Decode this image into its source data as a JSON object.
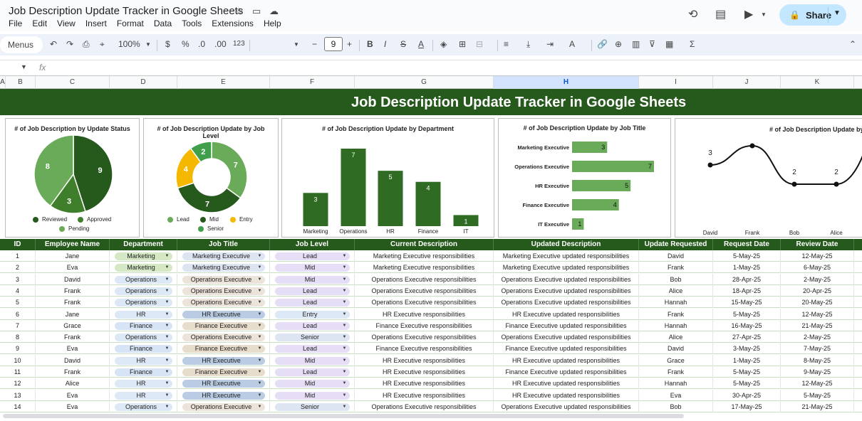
{
  "app": {
    "title": "Job Description Update Tracker in Google Sheets",
    "menus": [
      "File",
      "Edit",
      "View",
      "Insert",
      "Format",
      "Data",
      "Tools",
      "Extensions",
      "Help"
    ],
    "share_label": "Share"
  },
  "toolbar": {
    "menus_label": "Menus",
    "zoom": "100%",
    "currency": "$",
    "percent": "%",
    "dec_decrease": ".0",
    "dec_increase": ".00",
    "number_format": "123",
    "font_size": "9"
  },
  "formula": {
    "fx": "fx"
  },
  "columns": [
    "A",
    "B",
    "C",
    "D",
    "E",
    "F",
    "G",
    "H",
    "I",
    "J",
    "K"
  ],
  "selected_column": "H",
  "banner": {
    "title": "Job Description Update Tracker in Google Sheets"
  },
  "colors": {
    "dark_green": "#265a1c",
    "mid_green": "#3f7f2c",
    "light_green": "#6aab59",
    "amber": "#f5b800",
    "header_green": "#265a1c"
  },
  "charts": {
    "status": {
      "title": "# of Job Description by Update Status",
      "legend": [
        "Reviewed",
        "Approved",
        "Pending"
      ]
    },
    "level": {
      "title": "# of Job Description Update by Job Level",
      "legend": [
        "Lead",
        "Mid",
        "Entry",
        "Senior"
      ]
    },
    "department": {
      "title": "# of Job Description Update by Department"
    },
    "jobtitle": {
      "title": "# of Job Description Update by Job Title"
    },
    "requester": {
      "title": "# of Job Description Update by"
    }
  },
  "chart_data": [
    {
      "type": "pie",
      "title": "# of Job Description by Update Status",
      "categories": [
        "Reviewed",
        "Approved",
        "Pending"
      ],
      "values": [
        9,
        3,
        8
      ],
      "legend_position": "bottom"
    },
    {
      "type": "pie",
      "title": "# of Job Description Update by Job Level",
      "categories": [
        "Lead",
        "Mid",
        "Entry",
        "Senior"
      ],
      "values": [
        7,
        7,
        4,
        2
      ],
      "donut": true,
      "legend_position": "bottom"
    },
    {
      "type": "bar",
      "title": "# of Job Description Update by Department",
      "categories": [
        "Marketing",
        "Operations",
        "HR",
        "Finance",
        "IT"
      ],
      "values": [
        3,
        7,
        5,
        4,
        1
      ]
    },
    {
      "type": "bar",
      "orientation": "horizontal",
      "title": "# of Job Description Update by Job Title",
      "categories": [
        "Marketing Executive",
        "Operations Executive",
        "HR Executive",
        "Finance Executive",
        "IT Executive"
      ],
      "values": [
        3,
        7,
        5,
        4,
        1
      ]
    },
    {
      "type": "line",
      "title": "# of Job Description Update by",
      "categories": [
        "David",
        "Frank",
        "Bob",
        "Alice"
      ],
      "values": [
        3,
        4,
        2,
        2
      ],
      "smooth": true
    }
  ],
  "table": {
    "headers": [
      "ID",
      "Employee Name",
      "Department",
      "Job Title",
      "Job Level",
      "Current Description",
      "Updated Description",
      "Update Requested By",
      "Request Date",
      "Review Date"
    ],
    "rows": [
      [
        "1",
        "Jane",
        "Marketing",
        "Marketing Executive",
        "Lead",
        "Marketing Executive responsibilities",
        "Marketing Executive updated responsibilities",
        "David",
        "5-May-25",
        "12-May-25"
      ],
      [
        "2",
        "Eva",
        "Marketing",
        "Marketing Executive",
        "Mid",
        "Marketing Executive responsibilities",
        "Marketing Executive updated responsibilities",
        "Frank",
        "1-May-25",
        "6-May-25"
      ],
      [
        "3",
        "David",
        "Operations",
        "Operations Executive",
        "Mid",
        "Operations Executive responsibilities",
        "Operations Executive updated responsibilities",
        "Bob",
        "28-Apr-25",
        "2-May-25"
      ],
      [
        "4",
        "Frank",
        "Operations",
        "Operations Executive",
        "Lead",
        "Operations Executive responsibilities",
        "Operations Executive updated responsibilities",
        "Alice",
        "18-Apr-25",
        "20-Apr-25"
      ],
      [
        "5",
        "Frank",
        "Operations",
        "Operations Executive",
        "Lead",
        "Operations Executive responsibilities",
        "Operations Executive updated responsibilities",
        "Hannah",
        "15-May-25",
        "20-May-25"
      ],
      [
        "6",
        "Jane",
        "HR",
        "HR Executive",
        "Entry",
        "HR Executive responsibilities",
        "HR Executive updated responsibilities",
        "Frank",
        "5-May-25",
        "12-May-25"
      ],
      [
        "7",
        "Grace",
        "Finance",
        "Finance Executive",
        "Lead",
        "Finance Executive responsibilities",
        "Finance Executive updated responsibilities",
        "Hannah",
        "16-May-25",
        "21-May-25"
      ],
      [
        "8",
        "Frank",
        "Operations",
        "Operations Executive",
        "Senior",
        "Operations Executive responsibilities",
        "Operations Executive updated responsibilities",
        "Alice",
        "27-Apr-25",
        "2-May-25"
      ],
      [
        "9",
        "Eva",
        "Finance",
        "Finance Executive",
        "Lead",
        "Finance Executive responsibilities",
        "Finance Executive updated responsibilities",
        "David",
        "3-May-25",
        "7-May-25"
      ],
      [
        "10",
        "David",
        "HR",
        "HR Executive",
        "Mid",
        "HR Executive responsibilities",
        "HR Executive updated responsibilities",
        "Grace",
        "1-May-25",
        "8-May-25"
      ],
      [
        "11",
        "Frank",
        "Finance",
        "Finance Executive",
        "Lead",
        "HR Executive responsibilities",
        "Finance Executive updated responsibilities",
        "Frank",
        "5-May-25",
        "9-May-25"
      ],
      [
        "12",
        "Alice",
        "HR",
        "HR Executive",
        "Mid",
        "HR Executive responsibilities",
        "HR Executive updated responsibilities",
        "Hannah",
        "5-May-25",
        "12-May-25"
      ],
      [
        "13",
        "Eva",
        "HR",
        "HR Executive",
        "Mid",
        "HR Executive responsibilities",
        "HR Executive updated responsibilities",
        "Eva",
        "30-Apr-25",
        "5-May-25"
      ],
      [
        "14",
        "Eva",
        "Operations",
        "Operations Executive",
        "Senior",
        "Operations Executive responsibilities",
        "Operations Executive updated responsibilities",
        "Bob",
        "17-May-25",
        "21-May-25"
      ]
    ]
  }
}
